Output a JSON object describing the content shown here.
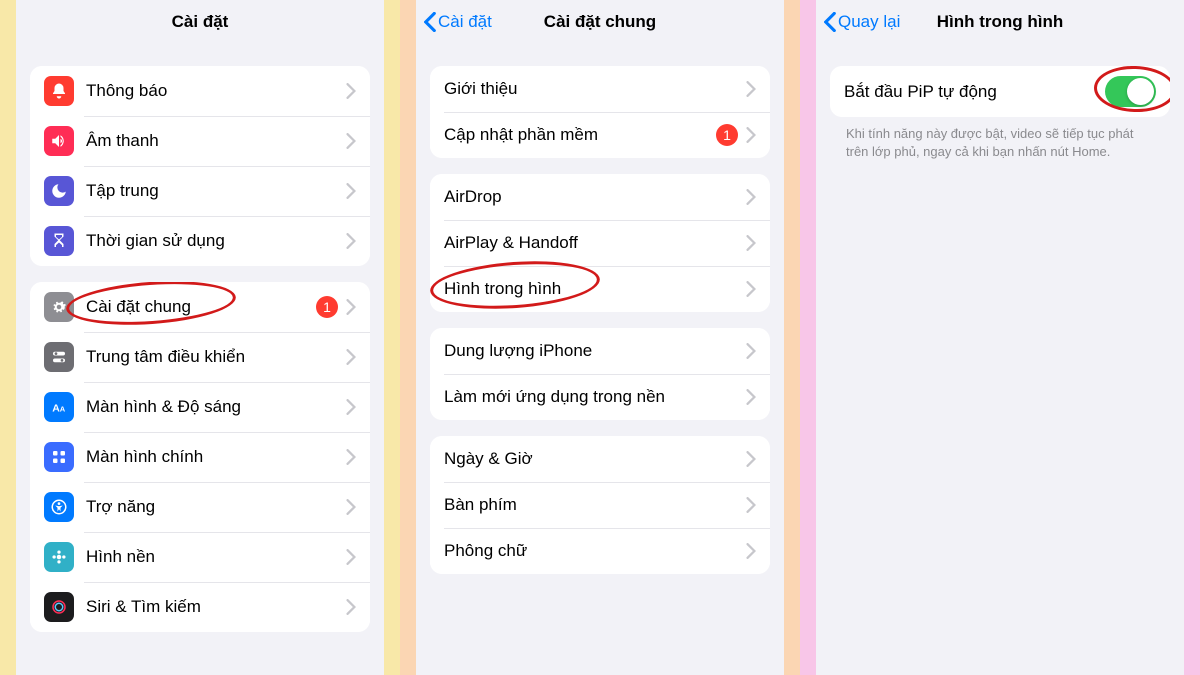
{
  "col1": {
    "title": "Cài đặt",
    "group1": [
      {
        "label": "Thông báo"
      },
      {
        "label": "Âm thanh"
      },
      {
        "label": "Tập trung"
      },
      {
        "label": "Thời gian sử dụng"
      }
    ],
    "group2": [
      {
        "label": "Cài đặt chung",
        "badge": "1"
      },
      {
        "label": "Trung tâm điều khiển"
      },
      {
        "label": "Màn hình & Độ sáng"
      },
      {
        "label": "Màn hình chính"
      },
      {
        "label": "Trợ năng"
      },
      {
        "label": "Hình nền"
      },
      {
        "label": "Siri & Tìm kiếm"
      }
    ]
  },
  "col2": {
    "back": "Cài đặt",
    "title": "Cài đặt chung",
    "group1": [
      {
        "label": "Giới thiệu"
      },
      {
        "label": "Cập nhật phần mềm",
        "badge": "1"
      }
    ],
    "group2": [
      {
        "label": "AirDrop"
      },
      {
        "label": "AirPlay & Handoff"
      },
      {
        "label": "Hình trong hình"
      }
    ],
    "group3": [
      {
        "label": "Dung lượng iPhone"
      },
      {
        "label": "Làm mới ứng dụng trong nền"
      }
    ],
    "group4": [
      {
        "label": "Ngày & Giờ"
      },
      {
        "label": "Bàn phím"
      },
      {
        "label": "Phông chữ"
      }
    ]
  },
  "col3": {
    "back": "Quay lại",
    "title": "Hình trong hình",
    "toggle_label": "Bắt đầu PiP tự động",
    "toggle_on": true,
    "footer": "Khi tính năng này được bật, video sẽ tiếp tục phát trên lớp phủ, ngay cả khi bạn nhấn nút Home."
  }
}
